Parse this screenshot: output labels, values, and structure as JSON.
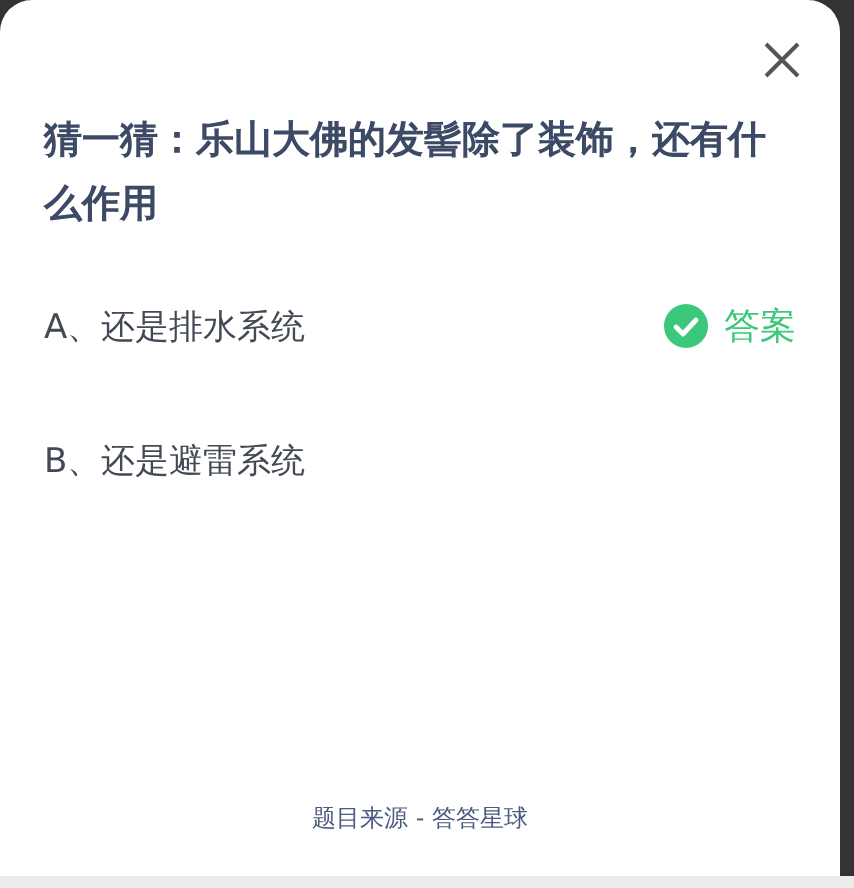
{
  "question": "猜一猜：乐山大佛的发髻除了装饰，还有什么作用",
  "options": [
    {
      "label": "A、还是排水系统",
      "correct": true
    },
    {
      "label": "B、还是避雷系统",
      "correct": false
    }
  ],
  "answer_label": "答案",
  "source": "题目来源 - 答答星球"
}
